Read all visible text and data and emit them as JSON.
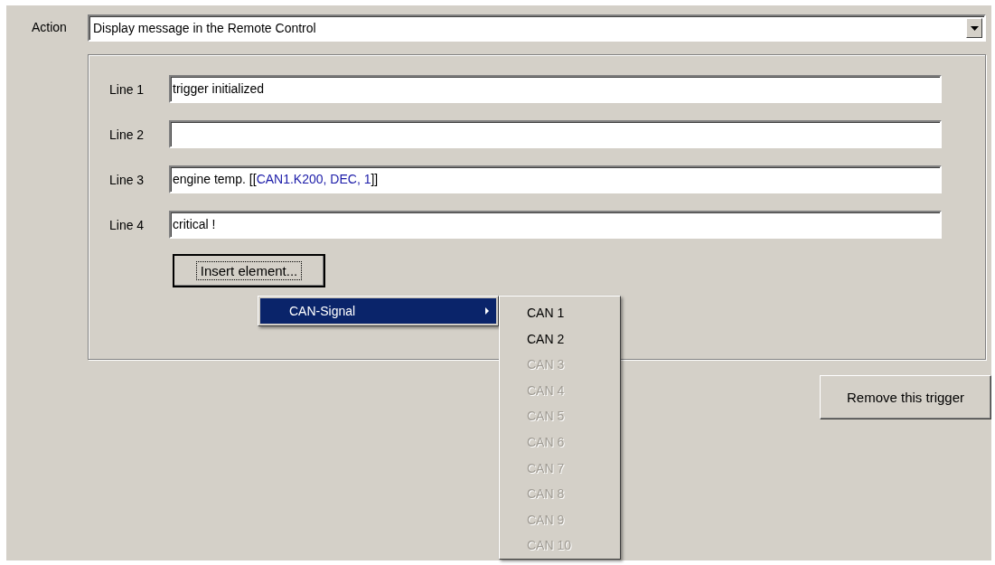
{
  "action": {
    "label": "Action",
    "value": "Display message in the Remote Control"
  },
  "lines": [
    {
      "label": "Line 1",
      "parts": [
        {
          "kind": "plain",
          "text": "trigger initialized"
        }
      ]
    },
    {
      "label": "Line 2"
    },
    {
      "label": "Line 3",
      "parts": [
        {
          "kind": "plain",
          "text": "engine temp. [["
        },
        {
          "kind": "token",
          "text": "CAN1.K200, DEC, 1"
        },
        {
          "kind": "plain",
          "text": "]]"
        }
      ]
    },
    {
      "label": "Line 4",
      "parts": [
        {
          "kind": "plain",
          "text": "critical !"
        }
      ]
    }
  ],
  "insert_button": {
    "label": "Insert element...",
    "focused": true
  },
  "menu": {
    "items": [
      {
        "label": "CAN-Signal",
        "selected": true,
        "submenu": true
      }
    ]
  },
  "submenu": {
    "items": [
      {
        "label": "CAN 1",
        "disabled": false
      },
      {
        "label": "CAN 2",
        "disabled": false
      },
      {
        "label": "CAN 3",
        "disabled": true
      },
      {
        "label": "CAN 4",
        "disabled": true
      },
      {
        "label": "CAN 5",
        "disabled": true
      },
      {
        "label": "CAN 6",
        "disabled": true
      },
      {
        "label": "CAN 7",
        "disabled": true
      },
      {
        "label": "CAN 8",
        "disabled": true
      },
      {
        "label": "CAN 9",
        "disabled": true
      },
      {
        "label": "CAN 10",
        "disabled": true
      }
    ]
  },
  "remove_button": {
    "label": "Remove this trigger"
  }
}
